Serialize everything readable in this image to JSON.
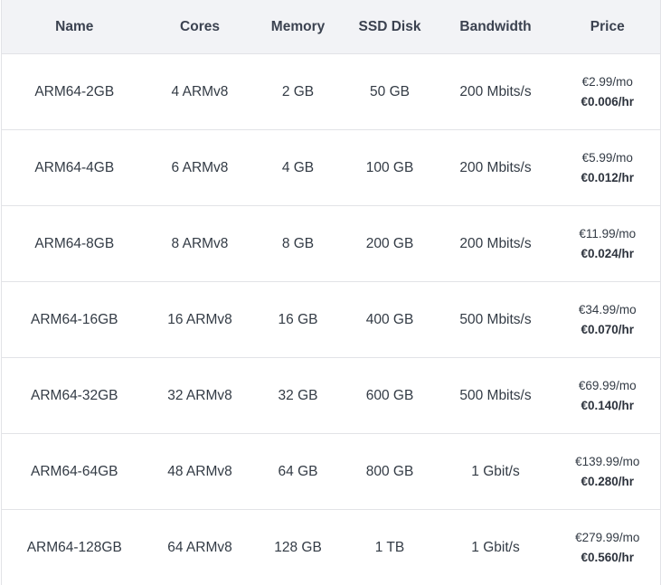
{
  "table": {
    "headers": [
      "Name",
      "Cores",
      "Memory",
      "SSD Disk",
      "Bandwidth",
      "Price"
    ],
    "rows": [
      {
        "name": "ARM64-2GB",
        "cores": "4 ARMv8",
        "memory": "2 GB",
        "ssd": "50 GB",
        "bandwidth": "200 Mbits/s",
        "price_month": "€2.99/mo",
        "price_hour": "€0.006/hr"
      },
      {
        "name": "ARM64-4GB",
        "cores": "6 ARMv8",
        "memory": "4 GB",
        "ssd": "100 GB",
        "bandwidth": "200 Mbits/s",
        "price_month": "€5.99/mo",
        "price_hour": "€0.012/hr"
      },
      {
        "name": "ARM64-8GB",
        "cores": "8 ARMv8",
        "memory": "8 GB",
        "ssd": "200 GB",
        "bandwidth": "200 Mbits/s",
        "price_month": "€11.99/mo",
        "price_hour": "€0.024/hr"
      },
      {
        "name": "ARM64-16GB",
        "cores": "16 ARMv8",
        "memory": "16 GB",
        "ssd": "400 GB",
        "bandwidth": "500 Mbits/s",
        "price_month": "€34.99/mo",
        "price_hour": "€0.070/hr"
      },
      {
        "name": "ARM64-32GB",
        "cores": "32 ARMv8",
        "memory": "32 GB",
        "ssd": "600 GB",
        "bandwidth": "500 Mbits/s",
        "price_month": "€69.99/mo",
        "price_hour": "€0.140/hr"
      },
      {
        "name": "ARM64-64GB",
        "cores": "48 ARMv8",
        "memory": "64 GB",
        "ssd": "800 GB",
        "bandwidth": "1 Gbit/s",
        "price_month": "€139.99/mo",
        "price_hour": "€0.280/hr"
      },
      {
        "name": "ARM64-128GB",
        "cores": "64 ARMv8",
        "memory": "128 GB",
        "ssd": "1 TB",
        "bandwidth": "1 Gbit/s",
        "price_month": "€279.99/mo",
        "price_hour": "€0.560/hr"
      }
    ]
  },
  "colors": {
    "header_background": "#f2f3f6",
    "border": "#e2e3e7",
    "text": "#333b45"
  }
}
